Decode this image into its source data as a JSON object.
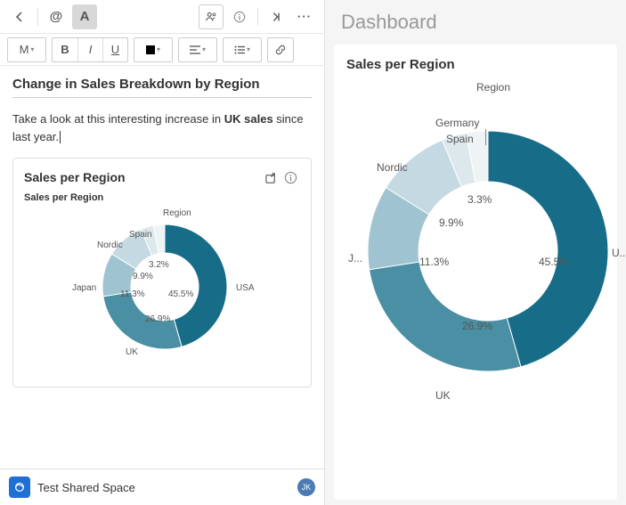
{
  "toolbar": {
    "at": "@",
    "a": "A",
    "m_label": "M"
  },
  "editor": {
    "heading": "Change in Sales Breakdown by Region",
    "para_pre": "Take a look at this interesting increase in ",
    "para_bold": "UK sales",
    "para_post": " since last year."
  },
  "embed": {
    "title": "Sales per Region",
    "subtitle": "Sales per Region",
    "legend_title": "Region"
  },
  "dashboard": {
    "title": "Dashboard",
    "card_title": "Sales per Region",
    "legend_title": "Region"
  },
  "footer": {
    "space": "Test Shared Space",
    "initials": "JK"
  },
  "chart_data": {
    "type": "pie",
    "title": "Sales per Region",
    "legend_title": "Region",
    "series": [
      {
        "name": "USA",
        "value": 45.5,
        "label": "45.5%",
        "color": "#176d87"
      },
      {
        "name": "UK",
        "value": 26.9,
        "label": "26.9%",
        "color": "#4a8fa3"
      },
      {
        "name": "Japan",
        "value": 11.3,
        "label": "11.3%",
        "color": "#9fc3d1"
      },
      {
        "name": "Nordic",
        "value": 9.9,
        "label": "9.9%",
        "color": "#c4d9e2"
      },
      {
        "name": "Spain",
        "value": 3.3,
        "label": "3.3%",
        "color": "#dde8ed"
      },
      {
        "name": "Germany",
        "value": 2.9,
        "label": "",
        "color": "#eef3f5"
      }
    ],
    "embed_labels": {
      "usa": "USA",
      "uk": "UK",
      "japan": "Japan",
      "nordic": "Nordic",
      "spain": "Spain",
      "p455": "45.5%",
      "p269": "26.9%",
      "p113": "11.3%",
      "p99": "9.9%",
      "p32": "3.2%"
    },
    "dash_labels": {
      "usa": "U...",
      "uk": "UK",
      "japan": "J...",
      "nordic": "Nordic",
      "spain": "Spain",
      "germany": "Germany",
      "p455": "45.5%",
      "p269": "26.9%",
      "p113": "11.3%",
      "p99": "9.9%",
      "p33": "3.3%"
    }
  }
}
